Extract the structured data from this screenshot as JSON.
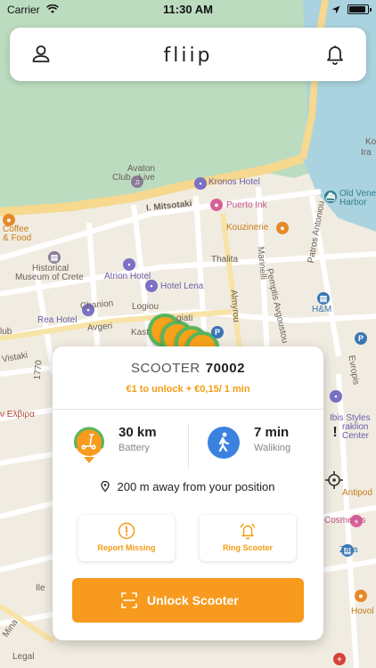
{
  "status_bar": {
    "carrier": "Carrier",
    "time": "11:30 AM",
    "battery_level": 0.9
  },
  "header": {
    "logo": "fliip"
  },
  "map": {
    "labels": [
      {
        "text": "Avaton",
        "cls": ""
      },
      {
        "text": "Club - Live",
        "cls": ""
      },
      {
        "text": "Kronos Hotel",
        "cls": "purple"
      },
      {
        "text": "I. Mitsotaki",
        "cls": "bold"
      },
      {
        "text": "Puerto Ink",
        "cls": "pink"
      },
      {
        "text": "Old Venet",
        "cls": "teal"
      },
      {
        "text": "Harbor",
        "cls": "teal"
      },
      {
        "text": "Coffee",
        "cls": "orange"
      },
      {
        "text": "& Food",
        "cls": "orange"
      },
      {
        "text": "Kouzinerie",
        "cls": "orange"
      },
      {
        "text": "Historical",
        "cls": ""
      },
      {
        "text": "Museum of Crete",
        "cls": ""
      },
      {
        "text": "Atrion Hotel",
        "cls": "purple"
      },
      {
        "text": "Thalita",
        "cls": ""
      },
      {
        "text": "Hotel Lena",
        "cls": "purple"
      },
      {
        "text": "H&M",
        "cls": "blue"
      },
      {
        "text": "Chanion",
        "cls": ""
      },
      {
        "text": "Logiou",
        "cls": ""
      },
      {
        "text": "Rea Hotel",
        "cls": "purple"
      },
      {
        "text": "Avgeri",
        "cls": ""
      },
      {
        "text": "lub",
        "cls": ""
      },
      {
        "text": "Kast",
        "cls": ""
      },
      {
        "text": "Vistaki",
        "cls": ""
      },
      {
        "text": "ν Ελβιρα",
        "cls": "red"
      },
      {
        "text": "Ibis Styles",
        "cls": "purple"
      },
      {
        "text": "raklion",
        "cls": "purple"
      },
      {
        "text": "Center",
        "cls": "purple"
      },
      {
        "text": "Antipod",
        "cls": "orange"
      },
      {
        "text": "Cosmetics",
        "cls": "pink"
      },
      {
        "text": "Zara",
        "cls": "blue"
      },
      {
        "text": "Hovol",
        "cls": "orange"
      },
      {
        "text": "Mina",
        "cls": ""
      },
      {
        "text": "Legal",
        "cls": ""
      },
      {
        "text": "Ko",
        "cls": ""
      },
      {
        "text": "Ira",
        "cls": ""
      },
      {
        "text": "Marinelli",
        "cls": ""
      },
      {
        "text": "Patros Antoniou",
        "cls": ""
      },
      {
        "text": "Pemptis Avgoustou",
        "cls": ""
      },
      {
        "text": "Almyrou",
        "cls": ""
      },
      {
        "text": "Evropis",
        "cls": ""
      },
      {
        "text": "1770",
        "cls": ""
      },
      {
        "text": "giati",
        "cls": ""
      },
      {
        "text": "Ile",
        "cls": ""
      }
    ]
  },
  "card": {
    "title_label": "SCOOTER",
    "scooter_id": "70002",
    "price": "€1  to unlock + €0,15/ 1 min",
    "battery_value": "30 km",
    "battery_label": "Battery",
    "walk_value": "7 min",
    "walk_label": "Waliking",
    "distance": "200 m away from your position",
    "report_label": "Report Missing",
    "ring_label": "Ring Scooter",
    "unlock_label": "Unlock Scooter"
  },
  "colors": {
    "accent": "#f79a1e",
    "battery_ring": "#57b65c",
    "walk": "#3b82e0"
  }
}
